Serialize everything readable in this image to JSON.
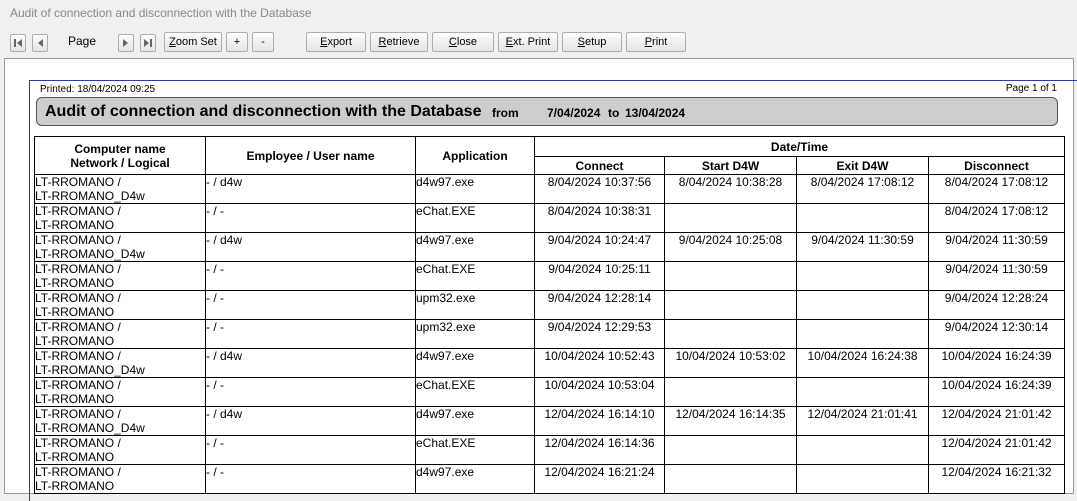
{
  "window": {
    "title": "Audit of connection and disconnection with the Database"
  },
  "toolbar": {
    "page_label": "Page",
    "zoom_set": "Zoom Set",
    "zoom_in": "+",
    "zoom_out": "-",
    "export": "Export",
    "retrieve": "Retrieve",
    "close": "Close",
    "ext_print": "Ext. Print",
    "setup": "Setup",
    "print": "Print"
  },
  "report": {
    "printed": "Printed: 18/04/2024 09:25",
    "page_info": "Page 1 of 1",
    "title": "Audit of connection and disconnection with the Database",
    "from_label": "from",
    "date_from": "7/04/2024",
    "to_label": "to",
    "date_to": "13/04/2024",
    "headers": {
      "computer_line1": "Computer name",
      "computer_line2": "Network / Logical",
      "employee": "Employee / User name",
      "application": "Application",
      "datetime": "Date/Time",
      "connect": "Connect",
      "start_d4w": "Start D4W",
      "exit_d4w": "Exit D4W",
      "disconnect": "Disconnect"
    },
    "rows": [
      {
        "comp1": "LT-RROMANO /",
        "comp2": "LT-RROMANO_D4w",
        "employee": "- / d4w",
        "app": "d4w97.exe",
        "connect": "8/04/2024 10:37:56",
        "start": "8/04/2024 10:38:28",
        "exit": "8/04/2024 17:08:12",
        "disconnect": "8/04/2024 17:08:12"
      },
      {
        "comp1": "LT-RROMANO /",
        "comp2": "LT-RROMANO",
        "employee": "- / -",
        "app": "eChat.EXE",
        "connect": "8/04/2024 10:38:31",
        "start": "",
        "exit": "",
        "disconnect": "8/04/2024 17:08:12"
      },
      {
        "comp1": "LT-RROMANO /",
        "comp2": "LT-RROMANO_D4w",
        "employee": "- / d4w",
        "app": "d4w97.exe",
        "connect": "9/04/2024 10:24:47",
        "start": "9/04/2024 10:25:08",
        "exit": "9/04/2024 11:30:59",
        "disconnect": "9/04/2024 11:30:59"
      },
      {
        "comp1": "LT-RROMANO /",
        "comp2": "LT-RROMANO",
        "employee": "- / -",
        "app": "eChat.EXE",
        "connect": "9/04/2024 10:25:11",
        "start": "",
        "exit": "",
        "disconnect": "9/04/2024 11:30:59"
      },
      {
        "comp1": "LT-RROMANO /",
        "comp2": "LT-RROMANO",
        "employee": "- / -",
        "app": "upm32.exe",
        "connect": "9/04/2024 12:28:14",
        "start": "",
        "exit": "",
        "disconnect": "9/04/2024 12:28:24"
      },
      {
        "comp1": "LT-RROMANO /",
        "comp2": "LT-RROMANO",
        "employee": "- / -",
        "app": "upm32.exe",
        "connect": "9/04/2024 12:29:53",
        "start": "",
        "exit": "",
        "disconnect": "9/04/2024 12:30:14"
      },
      {
        "comp1": "LT-RROMANO /",
        "comp2": "LT-RROMANO_D4w",
        "employee": "- / d4w",
        "app": "d4w97.exe",
        "connect": "10/04/2024 10:52:43",
        "start": "10/04/2024 10:53:02",
        "exit": "10/04/2024 16:24:38",
        "disconnect": "10/04/2024 16:24:39"
      },
      {
        "comp1": "LT-RROMANO /",
        "comp2": "LT-RROMANO",
        "employee": "- / -",
        "app": "eChat.EXE",
        "connect": "10/04/2024 10:53:04",
        "start": "",
        "exit": "",
        "disconnect": "10/04/2024 16:24:39"
      },
      {
        "comp1": "LT-RROMANO /",
        "comp2": "LT-RROMANO_D4w",
        "employee": "- / d4w",
        "app": "d4w97.exe",
        "connect": "12/04/2024 16:14:10",
        "start": "12/04/2024 16:14:35",
        "exit": "12/04/2024 21:01:41",
        "disconnect": "12/04/2024 21:01:42"
      },
      {
        "comp1": "LT-RROMANO /",
        "comp2": "LT-RROMANO",
        "employee": "- / -",
        "app": "eChat.EXE",
        "connect": "12/04/2024 16:14:36",
        "start": "",
        "exit": "",
        "disconnect": "12/04/2024 21:01:42"
      },
      {
        "comp1": "LT-RROMANO /",
        "comp2": "LT-RROMANO",
        "employee": "- / -",
        "app": "d4w97.exe",
        "connect": "12/04/2024 16:21:24",
        "start": "",
        "exit": "",
        "disconnect": "12/04/2024 16:21:32"
      }
    ]
  }
}
